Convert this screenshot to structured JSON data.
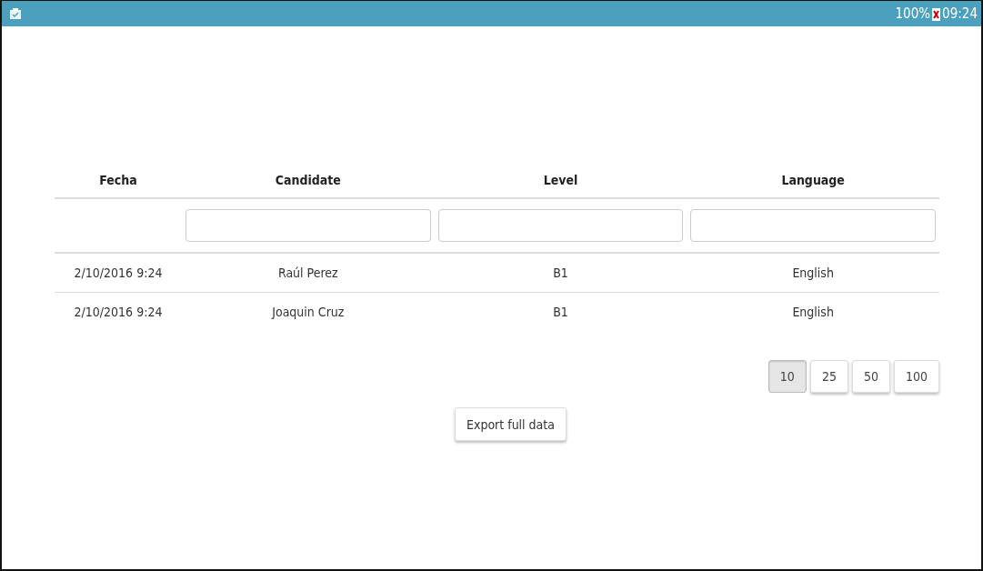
{
  "status_bar": {
    "battery": "100%",
    "time": "09:24"
  },
  "table": {
    "columns": [
      {
        "label": "Fecha",
        "filter": false
      },
      {
        "label": "Candidate",
        "filter": true
      },
      {
        "label": "Level",
        "filter": true
      },
      {
        "label": "Language",
        "filter": true
      }
    ],
    "rows": [
      [
        "2/10/2016 9:24",
        "Raúl Perez",
        "B1",
        "English"
      ],
      [
        "2/10/2016 9:24",
        "Joaquin Cruz",
        "B1",
        "English"
      ]
    ]
  },
  "page_sizes": [
    {
      "label": "10",
      "selected": true
    },
    {
      "label": "25",
      "selected": false
    },
    {
      "label": "50",
      "selected": false
    },
    {
      "label": "100",
      "selected": false
    }
  ],
  "export_button": "Export full data"
}
